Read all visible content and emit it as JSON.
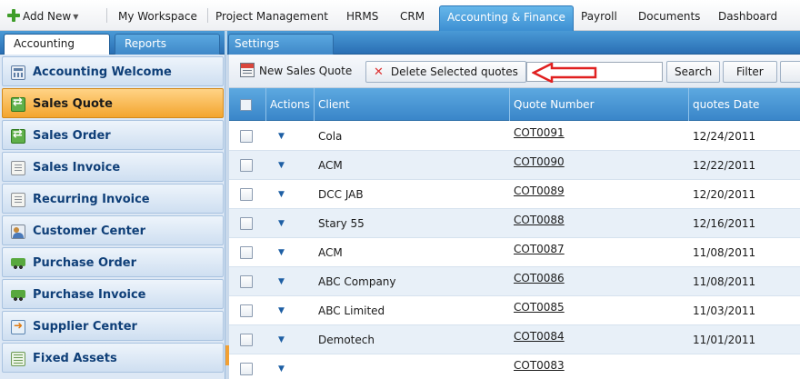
{
  "topnav": {
    "add_new": "Add New",
    "items": [
      "My Workspace",
      "Project Management",
      "HRMS",
      "CRM",
      "Accounting & Finance",
      "Payroll",
      "Documents",
      "Dashboard"
    ],
    "active": "Accounting & Finance"
  },
  "subnav": {
    "tabs": [
      "Accounting",
      "Reports",
      "Settings"
    ],
    "active": "Accounting"
  },
  "sidebar": {
    "items": [
      {
        "label": "Accounting Welcome",
        "icon": "calculator-icon"
      },
      {
        "label": "Sales Quote",
        "icon": "exchange-icon",
        "active": true
      },
      {
        "label": "Sales Order",
        "icon": "exchange-icon"
      },
      {
        "label": "Sales Invoice",
        "icon": "document-icon"
      },
      {
        "label": "Recurring Invoice",
        "icon": "document-icon"
      },
      {
        "label": "Customer Center",
        "icon": "people-icon"
      },
      {
        "label": "Purchase Order",
        "icon": "truck-icon"
      },
      {
        "label": "Purchase Invoice",
        "icon": "truck-icon"
      },
      {
        "label": "Supplier Center",
        "icon": "supplier-icon"
      },
      {
        "label": "Fixed Assets",
        "icon": "grid-icon"
      }
    ]
  },
  "toolbar": {
    "new_quote": "New Sales Quote",
    "delete_quotes": "Delete Selected quotes",
    "search_value": "",
    "search_button": "Search",
    "filter_button": "Filter"
  },
  "table": {
    "columns": [
      "Actions",
      "Client",
      "Quote Number",
      "quotes Date"
    ],
    "rows": [
      {
        "client": "Cola",
        "quote": "COT0091",
        "date": "12/24/2011"
      },
      {
        "client": "ACM",
        "quote": "COT0090",
        "date": "12/22/2011"
      },
      {
        "client": "DCC JAB",
        "quote": "COT0089",
        "date": "12/20/2011"
      },
      {
        "client": "Stary 55",
        "quote": "COT0088",
        "date": "12/16/2011"
      },
      {
        "client": "ACM",
        "quote": "COT0087",
        "date": "11/08/2011"
      },
      {
        "client": "ABC Company",
        "quote": "COT0086",
        "date": "11/08/2011"
      },
      {
        "client": "ABC Limited",
        "quote": "COT0085",
        "date": "11/03/2011"
      },
      {
        "client": "Demotech",
        "quote": "COT0084",
        "date": "11/01/2011"
      },
      {
        "client": "",
        "quote": "COT0083",
        "date": ""
      }
    ]
  },
  "colors": {
    "accent_blue": "#3d8fd2",
    "active_orange": "#f3a52e",
    "sidebar_text": "#0f3f78",
    "annotation_red": "#e02020"
  }
}
